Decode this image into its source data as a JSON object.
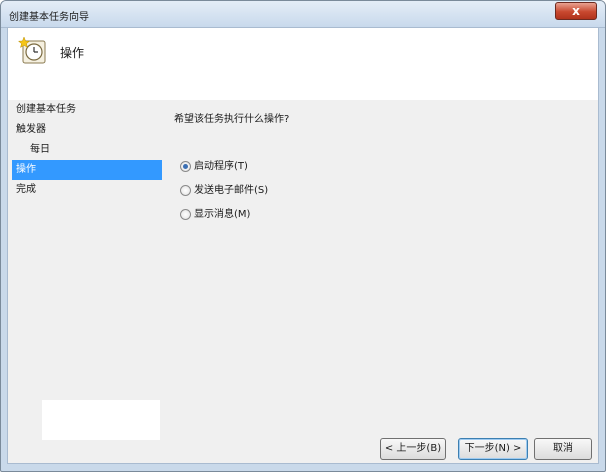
{
  "window": {
    "title": "创建基本任务向导",
    "close_label": "x"
  },
  "header": {
    "icon": "scheduler-clock-icon",
    "title": "操作"
  },
  "steps": [
    {
      "label": "创建基本任务",
      "sub": false,
      "active": false
    },
    {
      "label": "触发器",
      "sub": false,
      "active": false
    },
    {
      "label": "每日",
      "sub": true,
      "active": false
    },
    {
      "label": "操作",
      "sub": false,
      "active": true
    },
    {
      "label": "完成",
      "sub": false,
      "active": false
    }
  ],
  "content": {
    "question": "希望该任务执行什么操作?",
    "options": [
      {
        "label": "启动程序(T)",
        "checked": true
      },
      {
        "label": "发送电子邮件(S)",
        "checked": false
      },
      {
        "label": "显示消息(M)",
        "checked": false
      }
    ]
  },
  "buttons": {
    "back": "< 上一步(B)",
    "next": "下一步(N) >",
    "cancel": "取消"
  },
  "colors": {
    "selection": "#3399ff",
    "titlebar": "#c8d9ec",
    "close": "#c8482f"
  }
}
